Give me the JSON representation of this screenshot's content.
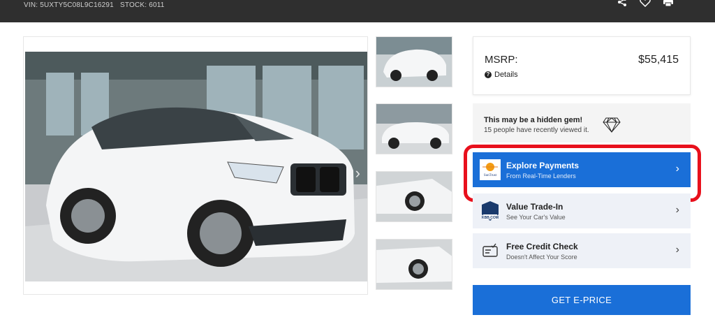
{
  "header": {
    "vin": "VIN: 5UXTY5C08L9C16291",
    "stock": "STOCK: 6011",
    "icons": [
      "share-icon",
      "heart-icon",
      "print-icon"
    ]
  },
  "gallery": {
    "main_photo": "vehicle-main-photo",
    "thumbnails": [
      "thumbnail-1",
      "thumbnail-2",
      "thumbnail-3",
      "thumbnail-4"
    ]
  },
  "pricing": {
    "msrp_label": "MSRP:",
    "msrp_value": "$55,415",
    "details_label": "Details"
  },
  "gem": {
    "title": "This may be a hidden gem!",
    "subtitle": "15 people have recently viewed it."
  },
  "actions": [
    {
      "title": "Explore Payments",
      "subtitle": "From Real-Time Lenders",
      "icon": "suntrust-logo",
      "logo_text": "SunTrust"
    },
    {
      "title": "Value Trade-In",
      "subtitle": "See Your Car's Value",
      "icon": "kbb-logo",
      "logo_text": "KBB.COM"
    },
    {
      "title": "Free Credit Check",
      "subtitle": "Doesn't Affect Your Score",
      "icon": "credit-check-icon"
    }
  ],
  "cta": {
    "eprice_label": "GET E-PRICE"
  },
  "colors": {
    "accent_blue": "#1a6fd8",
    "highlight_red": "#e8101c",
    "header_bg": "#2f2f2f"
  }
}
